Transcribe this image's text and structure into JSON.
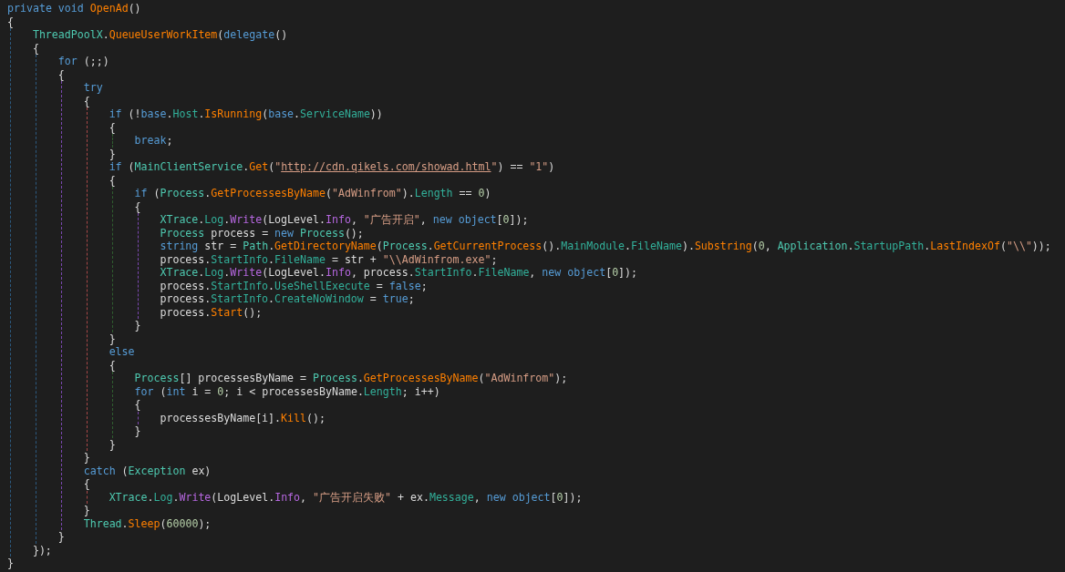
{
  "code": [
    {
      "tokens": [
        {
          "kind": "keyword",
          "text": "private void "
        },
        {
          "kind": "method",
          "text": "OpenAd"
        },
        {
          "kind": "plain",
          "text": "()"
        }
      ]
    },
    {
      "tokens": [
        {
          "kind": "plain",
          "text": "{"
        }
      ],
      "children": [
        {
          "tokens": [
            {
              "kind": "type",
              "text": "ThreadPoolX"
            },
            {
              "kind": "plain",
              "text": "."
            },
            {
              "kind": "method",
              "text": "QueueUserWorkItem"
            },
            {
              "kind": "plain",
              "text": "("
            },
            {
              "kind": "keyword",
              "text": "delegate"
            },
            {
              "kind": "plain",
              "text": "()"
            }
          ]
        },
        {
          "tokens": [
            {
              "kind": "plain",
              "text": "{"
            }
          ],
          "children": [
            {
              "tokens": [
                {
                  "kind": "keyword",
                  "text": "for"
                },
                {
                  "kind": "plain",
                  "text": " (;;)"
                }
              ]
            },
            {
              "tokens": [
                {
                  "kind": "plain",
                  "text": "{"
                }
              ],
              "children": [
                {
                  "tokens": [
                    {
                      "kind": "keyword",
                      "text": "try"
                    }
                  ]
                },
                {
                  "tokens": [
                    {
                      "kind": "plain",
                      "text": "{"
                    }
                  ],
                  "children": [
                    {
                      "tokens": [
                        {
                          "kind": "keyword",
                          "text": "if"
                        },
                        {
                          "kind": "plain",
                          "text": " (!"
                        },
                        {
                          "kind": "keyword",
                          "text": "base"
                        },
                        {
                          "kind": "plain",
                          "text": "."
                        },
                        {
                          "kind": "property",
                          "text": "Host"
                        },
                        {
                          "kind": "plain",
                          "text": "."
                        },
                        {
                          "kind": "method",
                          "text": "IsRunning"
                        },
                        {
                          "kind": "plain",
                          "text": "("
                        },
                        {
                          "kind": "keyword",
                          "text": "base"
                        },
                        {
                          "kind": "plain",
                          "text": "."
                        },
                        {
                          "kind": "property",
                          "text": "ServiceName"
                        },
                        {
                          "kind": "plain",
                          "text": "))"
                        }
                      ]
                    },
                    {
                      "tokens": [
                        {
                          "kind": "plain",
                          "text": "{"
                        }
                      ],
                      "children": [
                        {
                          "tokens": [
                            {
                              "kind": "keyword",
                              "text": "break"
                            },
                            {
                              "kind": "plain",
                              "text": ";"
                            }
                          ]
                        }
                      ]
                    },
                    {
                      "tokens": [
                        {
                          "kind": "plain",
                          "text": "}"
                        }
                      ]
                    },
                    {
                      "tokens": [
                        {
                          "kind": "keyword",
                          "text": "if"
                        },
                        {
                          "kind": "plain",
                          "text": " ("
                        },
                        {
                          "kind": "type",
                          "text": "MainClientService"
                        },
                        {
                          "kind": "plain",
                          "text": "."
                        },
                        {
                          "kind": "method",
                          "text": "Get"
                        },
                        {
                          "kind": "plain",
                          "text": "("
                        },
                        {
                          "kind": "string",
                          "text": "\""
                        },
                        {
                          "kind": "link",
                          "text": "http://cdn.qikels.com/showad.html"
                        },
                        {
                          "kind": "string",
                          "text": "\""
                        },
                        {
                          "kind": "plain",
                          "text": ") == "
                        },
                        {
                          "kind": "string",
                          "text": "\"1\""
                        },
                        {
                          "kind": "plain",
                          "text": ")"
                        }
                      ]
                    },
                    {
                      "tokens": [
                        {
                          "kind": "plain",
                          "text": "{"
                        }
                      ],
                      "children": [
                        {
                          "tokens": [
                            {
                              "kind": "keyword",
                              "text": "if"
                            },
                            {
                              "kind": "plain",
                              "text": " ("
                            },
                            {
                              "kind": "type",
                              "text": "Process"
                            },
                            {
                              "kind": "plain",
                              "text": "."
                            },
                            {
                              "kind": "method",
                              "text": "GetProcessesByName"
                            },
                            {
                              "kind": "plain",
                              "text": "("
                            },
                            {
                              "kind": "string",
                              "text": "\"AdWinfrom\""
                            },
                            {
                              "kind": "plain",
                              "text": ")."
                            },
                            {
                              "kind": "property",
                              "text": "Length"
                            },
                            {
                              "kind": "plain",
                              "text": " == "
                            },
                            {
                              "kind": "number",
                              "text": "0"
                            },
                            {
                              "kind": "plain",
                              "text": ")"
                            }
                          ]
                        },
                        {
                          "tokens": [
                            {
                              "kind": "plain",
                              "text": "{"
                            }
                          ],
                          "children": [
                            {
                              "tokens": [
                                {
                                  "kind": "type",
                                  "text": "XTrace"
                                },
                                {
                                  "kind": "plain",
                                  "text": "."
                                },
                                {
                                  "kind": "property",
                                  "text": "Log"
                                },
                                {
                                  "kind": "plain",
                                  "text": "."
                                },
                                {
                                  "kind": "static",
                                  "text": "Write"
                                },
                                {
                                  "kind": "plain",
                                  "text": "(LogLevel."
                                },
                                {
                                  "kind": "static",
                                  "text": "Info"
                                },
                                {
                                  "kind": "plain",
                                  "text": ", "
                                },
                                {
                                  "kind": "string",
                                  "text": "\"广告开启\""
                                },
                                {
                                  "kind": "plain",
                                  "text": ", "
                                },
                                {
                                  "kind": "keyword",
                                  "text": "new object"
                                },
                                {
                                  "kind": "plain",
                                  "text": "["
                                },
                                {
                                  "kind": "number",
                                  "text": "0"
                                },
                                {
                                  "kind": "plain",
                                  "text": "]);"
                                }
                              ]
                            },
                            {
                              "tokens": [
                                {
                                  "kind": "type",
                                  "text": "Process"
                                },
                                {
                                  "kind": "plain",
                                  "text": " process = "
                                },
                                {
                                  "kind": "keyword",
                                  "text": "new "
                                },
                                {
                                  "kind": "type",
                                  "text": "Process"
                                },
                                {
                                  "kind": "plain",
                                  "text": "();"
                                }
                              ]
                            },
                            {
                              "tokens": [
                                {
                                  "kind": "keyword",
                                  "text": "string"
                                },
                                {
                                  "kind": "plain",
                                  "text": " str = "
                                },
                                {
                                  "kind": "type",
                                  "text": "Path"
                                },
                                {
                                  "kind": "plain",
                                  "text": "."
                                },
                                {
                                  "kind": "method",
                                  "text": "GetDirectoryName"
                                },
                                {
                                  "kind": "plain",
                                  "text": "("
                                },
                                {
                                  "kind": "type",
                                  "text": "Process"
                                },
                                {
                                  "kind": "plain",
                                  "text": "."
                                },
                                {
                                  "kind": "method",
                                  "text": "GetCurrentProcess"
                                },
                                {
                                  "kind": "plain",
                                  "text": "()."
                                },
                                {
                                  "kind": "property",
                                  "text": "MainModule"
                                },
                                {
                                  "kind": "plain",
                                  "text": "."
                                },
                                {
                                  "kind": "property",
                                  "text": "FileName"
                                },
                                {
                                  "kind": "plain",
                                  "text": ")."
                                },
                                {
                                  "kind": "method",
                                  "text": "Substring"
                                },
                                {
                                  "kind": "plain",
                                  "text": "("
                                },
                                {
                                  "kind": "number",
                                  "text": "0"
                                },
                                {
                                  "kind": "plain",
                                  "text": ", "
                                },
                                {
                                  "kind": "type",
                                  "text": "Application"
                                },
                                {
                                  "kind": "plain",
                                  "text": "."
                                },
                                {
                                  "kind": "property",
                                  "text": "StartupPath"
                                },
                                {
                                  "kind": "plain",
                                  "text": "."
                                },
                                {
                                  "kind": "method",
                                  "text": "LastIndexOf"
                                },
                                {
                                  "kind": "plain",
                                  "text": "("
                                },
                                {
                                  "kind": "string",
                                  "text": "\"\\\\\""
                                },
                                {
                                  "kind": "plain",
                                  "text": "));"
                                }
                              ]
                            },
                            {
                              "tokens": [
                                {
                                  "kind": "plain",
                                  "text": "process."
                                },
                                {
                                  "kind": "property",
                                  "text": "StartInfo"
                                },
                                {
                                  "kind": "plain",
                                  "text": "."
                                },
                                {
                                  "kind": "property",
                                  "text": "FileName"
                                },
                                {
                                  "kind": "plain",
                                  "text": " = str + "
                                },
                                {
                                  "kind": "string",
                                  "text": "\"\\\\AdWinfrom.exe\""
                                },
                                {
                                  "kind": "plain",
                                  "text": ";"
                                }
                              ]
                            },
                            {
                              "tokens": [
                                {
                                  "kind": "type",
                                  "text": "XTrace"
                                },
                                {
                                  "kind": "plain",
                                  "text": "."
                                },
                                {
                                  "kind": "property",
                                  "text": "Log"
                                },
                                {
                                  "kind": "plain",
                                  "text": "."
                                },
                                {
                                  "kind": "static",
                                  "text": "Write"
                                },
                                {
                                  "kind": "plain",
                                  "text": "(LogLevel."
                                },
                                {
                                  "kind": "static",
                                  "text": "Info"
                                },
                                {
                                  "kind": "plain",
                                  "text": ", process."
                                },
                                {
                                  "kind": "property",
                                  "text": "StartInfo"
                                },
                                {
                                  "kind": "plain",
                                  "text": "."
                                },
                                {
                                  "kind": "property",
                                  "text": "FileName"
                                },
                                {
                                  "kind": "plain",
                                  "text": ", "
                                },
                                {
                                  "kind": "keyword",
                                  "text": "new object"
                                },
                                {
                                  "kind": "plain",
                                  "text": "["
                                },
                                {
                                  "kind": "number",
                                  "text": "0"
                                },
                                {
                                  "kind": "plain",
                                  "text": "]);"
                                }
                              ]
                            },
                            {
                              "tokens": [
                                {
                                  "kind": "plain",
                                  "text": "process."
                                },
                                {
                                  "kind": "property",
                                  "text": "StartInfo"
                                },
                                {
                                  "kind": "plain",
                                  "text": "."
                                },
                                {
                                  "kind": "property",
                                  "text": "UseShellExecute"
                                },
                                {
                                  "kind": "plain",
                                  "text": " = "
                                },
                                {
                                  "kind": "keyword",
                                  "text": "false"
                                },
                                {
                                  "kind": "plain",
                                  "text": ";"
                                }
                              ]
                            },
                            {
                              "tokens": [
                                {
                                  "kind": "plain",
                                  "text": "process."
                                },
                                {
                                  "kind": "property",
                                  "text": "StartInfo"
                                },
                                {
                                  "kind": "plain",
                                  "text": "."
                                },
                                {
                                  "kind": "property",
                                  "text": "CreateNoWindow"
                                },
                                {
                                  "kind": "plain",
                                  "text": " = "
                                },
                                {
                                  "kind": "keyword",
                                  "text": "true"
                                },
                                {
                                  "kind": "plain",
                                  "text": ";"
                                }
                              ]
                            },
                            {
                              "tokens": [
                                {
                                  "kind": "plain",
                                  "text": "process."
                                },
                                {
                                  "kind": "method",
                                  "text": "Start"
                                },
                                {
                                  "kind": "plain",
                                  "text": "();"
                                }
                              ]
                            }
                          ]
                        },
                        {
                          "tokens": [
                            {
                              "kind": "plain",
                              "text": "}"
                            }
                          ]
                        }
                      ]
                    },
                    {
                      "tokens": [
                        {
                          "kind": "plain",
                          "text": "}"
                        }
                      ]
                    },
                    {
                      "tokens": [
                        {
                          "kind": "keyword",
                          "text": "else"
                        }
                      ]
                    },
                    {
                      "tokens": [
                        {
                          "kind": "plain",
                          "text": "{"
                        }
                      ],
                      "children": [
                        {
                          "tokens": [
                            {
                              "kind": "type",
                              "text": "Process"
                            },
                            {
                              "kind": "plain",
                              "text": "[] processesByName = "
                            },
                            {
                              "kind": "type",
                              "text": "Process"
                            },
                            {
                              "kind": "plain",
                              "text": "."
                            },
                            {
                              "kind": "method",
                              "text": "GetProcessesByName"
                            },
                            {
                              "kind": "plain",
                              "text": "("
                            },
                            {
                              "kind": "string",
                              "text": "\"AdWinfrom\""
                            },
                            {
                              "kind": "plain",
                              "text": ");"
                            }
                          ]
                        },
                        {
                          "tokens": [
                            {
                              "kind": "keyword",
                              "text": "for"
                            },
                            {
                              "kind": "plain",
                              "text": " ("
                            },
                            {
                              "kind": "keyword",
                              "text": "int"
                            },
                            {
                              "kind": "plain",
                              "text": " i = "
                            },
                            {
                              "kind": "number",
                              "text": "0"
                            },
                            {
                              "kind": "plain",
                              "text": "; i < processesByName."
                            },
                            {
                              "kind": "property",
                              "text": "Length"
                            },
                            {
                              "kind": "plain",
                              "text": "; i++)"
                            }
                          ]
                        },
                        {
                          "tokens": [
                            {
                              "kind": "plain",
                              "text": "{"
                            }
                          ],
                          "children": [
                            {
                              "tokens": [
                                {
                                  "kind": "plain",
                                  "text": "processesByName[i]."
                                },
                                {
                                  "kind": "method",
                                  "text": "Kill"
                                },
                                {
                                  "kind": "plain",
                                  "text": "();"
                                }
                              ]
                            }
                          ]
                        },
                        {
                          "tokens": [
                            {
                              "kind": "plain",
                              "text": "}"
                            }
                          ]
                        }
                      ]
                    },
                    {
                      "tokens": [
                        {
                          "kind": "plain",
                          "text": "}"
                        }
                      ]
                    }
                  ]
                },
                {
                  "tokens": [
                    {
                      "kind": "plain",
                      "text": "}"
                    }
                  ]
                },
                {
                  "tokens": [
                    {
                      "kind": "keyword",
                      "text": "catch"
                    },
                    {
                      "kind": "plain",
                      "text": " ("
                    },
                    {
                      "kind": "type",
                      "text": "Exception"
                    },
                    {
                      "kind": "plain",
                      "text": " ex)"
                    }
                  ]
                },
                {
                  "tokens": [
                    {
                      "kind": "plain",
                      "text": "{"
                    }
                  ],
                  "children": [
                    {
                      "tokens": [
                        {
                          "kind": "type",
                          "text": "XTrace"
                        },
                        {
                          "kind": "plain",
                          "text": "."
                        },
                        {
                          "kind": "property",
                          "text": "Log"
                        },
                        {
                          "kind": "plain",
                          "text": "."
                        },
                        {
                          "kind": "static",
                          "text": "Write"
                        },
                        {
                          "kind": "plain",
                          "text": "(LogLevel."
                        },
                        {
                          "kind": "static",
                          "text": "Info"
                        },
                        {
                          "kind": "plain",
                          "text": ", "
                        },
                        {
                          "kind": "string",
                          "text": "\"广告开启失败\""
                        },
                        {
                          "kind": "plain",
                          "text": " + ex."
                        },
                        {
                          "kind": "property",
                          "text": "Message"
                        },
                        {
                          "kind": "plain",
                          "text": ", "
                        },
                        {
                          "kind": "keyword",
                          "text": "new object"
                        },
                        {
                          "kind": "plain",
                          "text": "["
                        },
                        {
                          "kind": "number",
                          "text": "0"
                        },
                        {
                          "kind": "plain",
                          "text": "]);"
                        }
                      ]
                    }
                  ]
                },
                {
                  "tokens": [
                    {
                      "kind": "plain",
                      "text": "}"
                    }
                  ]
                },
                {
                  "tokens": [
                    {
                      "kind": "type",
                      "text": "Thread"
                    },
                    {
                      "kind": "plain",
                      "text": "."
                    },
                    {
                      "kind": "method",
                      "text": "Sleep"
                    },
                    {
                      "kind": "plain",
                      "text": "("
                    },
                    {
                      "kind": "number",
                      "text": "60000"
                    },
                    {
                      "kind": "plain",
                      "text": ");"
                    }
                  ]
                }
              ]
            },
            {
              "tokens": [
                {
                  "kind": "plain",
                  "text": "}"
                }
              ]
            }
          ]
        },
        {
          "tokens": [
            {
              "kind": "plain",
              "text": "});"
            }
          ]
        }
      ]
    },
    {
      "tokens": [
        {
          "kind": "plain",
          "text": "}"
        }
      ]
    }
  ]
}
